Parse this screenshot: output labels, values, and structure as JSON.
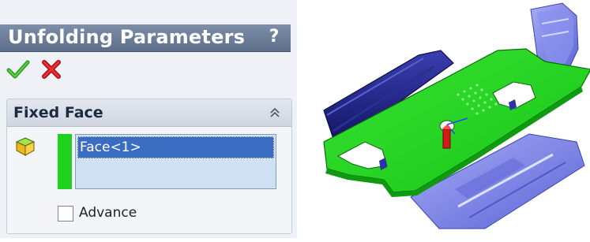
{
  "panel": {
    "title": "Unfolding Parameters",
    "help_label": "?",
    "ok_icon": "checkmark-icon",
    "cancel_icon": "x-icon"
  },
  "fixed_face_group": {
    "title": "Fixed Face",
    "selection": "Face<1>",
    "swatch_color": "#1dd11d",
    "advance_label": "Advance",
    "advance_checked": false
  },
  "viewport": {
    "model_description_icon": "sheet-metal-part",
    "colors": {
      "fixed_face": "#22d41e",
      "body": "#7c85e6",
      "dark_body": "#1b1f7a"
    }
  }
}
